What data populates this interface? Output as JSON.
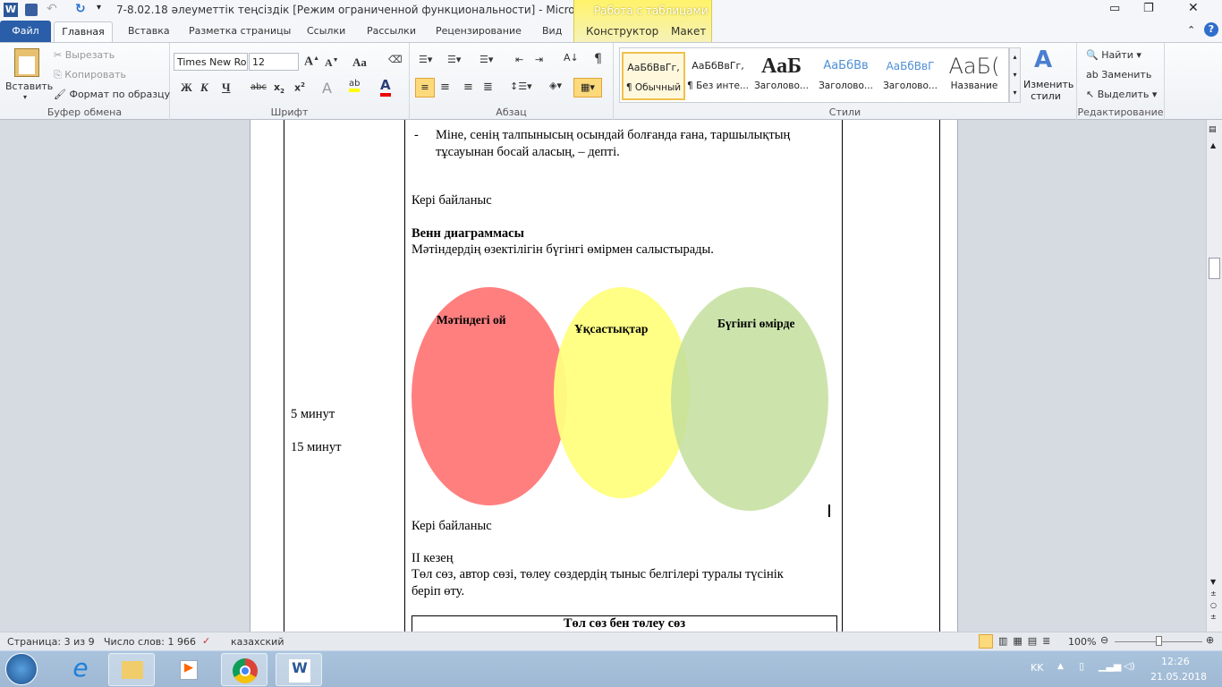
{
  "title": "7-8.02.18 әлеуметтік теңсіздік [Режим ограниченной функциональности]  -  Microsoft Word",
  "context_tab": "Работа с таблицами",
  "tabs": [
    "Файл",
    "Главная",
    "Вставка",
    "Разметка страницы",
    "Ссылки",
    "Рассылки",
    "Рецензирование",
    "Вид",
    "Конструктор",
    "Макет"
  ],
  "clipboard": {
    "paste": "Вставить",
    "cut": "Вырезать",
    "copy": "Копировать",
    "format": "Формат по образцу",
    "label": "Буфер обмена"
  },
  "font": {
    "name": "Times New Roman",
    "size": "12",
    "label": "Шрифт",
    "bold": "Ж",
    "italic": "К",
    "underline": "Ч",
    "strike": "abc",
    "case": "Aa"
  },
  "paragraph": {
    "label": "Абзац"
  },
  "styles": {
    "label": "Стили",
    "items": [
      {
        "preview": "АаБбВвГг,",
        "name": "¶ Обычный"
      },
      {
        "preview": "АаБбВвГг,",
        "name": "¶ Без инте..."
      },
      {
        "preview": "АаБ",
        "name": "Заголово..."
      },
      {
        "preview": "АаБбВв",
        "name": "Заголово..."
      },
      {
        "preview": "АаБбВвГ",
        "name": "Заголово..."
      },
      {
        "preview": "АаБ(",
        "name": "Название"
      }
    ],
    "change": "Изменить стили"
  },
  "editing": {
    "label": "Редактирование",
    "find": "Найти",
    "replace": "Заменить",
    "select": "Выделить"
  },
  "document": {
    "time1": "5 минут",
    "time2": "15 минут",
    "bullet": "Міне, сенің талпынысың осындай болғанда ғана, таршылықтың",
    "bullet2": "тұсауынан босай аласың, – депті.",
    "feedback1": "Кері байланыс",
    "venn_title": "Венн диаграммасы",
    "venn_desc": "Мәтіндердің өзектілігін бүгінгі өмірмен салыстырады.",
    "venn": {
      "left": "Мәтіндегі ой",
      "middle": "Ұқсастықтар",
      "right": "Бүгінгі өмірде",
      "colors": {
        "left": "#ff7f7f",
        "middle": "#ffff80",
        "right": "#c3df9c"
      }
    },
    "feedback2": "Кері байланыс",
    "stage": "ІІ кезең",
    "stage_desc1": "Төл сөз, автор сөзі, төлеу сөздердің тыныс белгілері  туралы түсінік",
    "stage_desc2": "беріп өту.",
    "table_header": "Төл сөз бен төлеу сөз"
  },
  "status": {
    "page": "Страница: 3 из 9",
    "words": "Число слов: 1 966",
    "lang": "казахский",
    "zoom": "100%"
  },
  "tray": {
    "lang": "KK",
    "time": "12:26",
    "date": "21.05.2018"
  }
}
